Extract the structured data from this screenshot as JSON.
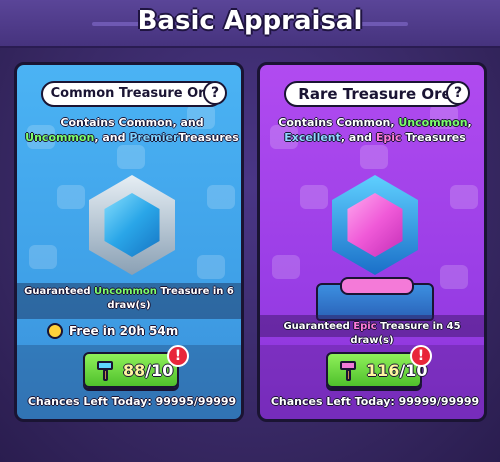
{
  "page_title": "Basic Appraisal",
  "cards": {
    "common": {
      "title": "Common Treasure Ore",
      "help_glyph": "?",
      "desc_line1_prefix": "Contains ",
      "desc_common": "Common",
      "desc_line1_suffix": ", and",
      "desc_uncommon": "Uncommon",
      "desc_and": ", and",
      "desc_premier": "Premier",
      "desc_end": "Treasures",
      "guarantee_prefix": "Guaranteed ",
      "guarantee_rarity": "Uncommon",
      "guarantee_suffix": " Treasure in 6 draw(s)",
      "free_text": "Free in 20h 54m",
      "draw_count": "88",
      "draw_total": "/10",
      "alert_glyph": "!",
      "chances": "Chances Left Today: 99995/99999",
      "accent": "#4bb3f4"
    },
    "rare": {
      "title": "Rare Treasure Ore",
      "help_glyph": "?",
      "desc_line1_prefix": "Contains ",
      "desc_common": "Common",
      "desc_comma": ", ",
      "desc_uncommon": "Uncommon",
      "desc_comma2": ",",
      "desc_excellent": "Excellent",
      "desc_and": ", and ",
      "desc_epic": "Epic",
      "desc_end": " Treasures",
      "guarantee_prefix": "Guaranteed ",
      "guarantee_rarity": "Epic",
      "guarantee_suffix": " Treasure in 45 draw(s)",
      "draw_count": "116",
      "draw_total": "/10",
      "alert_glyph": "!",
      "chances": "Chances Left Today: 99999/99999",
      "accent": "#b14bf0"
    }
  },
  "icons": {
    "help": "question-circle-icon",
    "timer": "stopwatch-icon",
    "hammer": "hammer-icon",
    "alert": "exclamation-badge-icon"
  }
}
